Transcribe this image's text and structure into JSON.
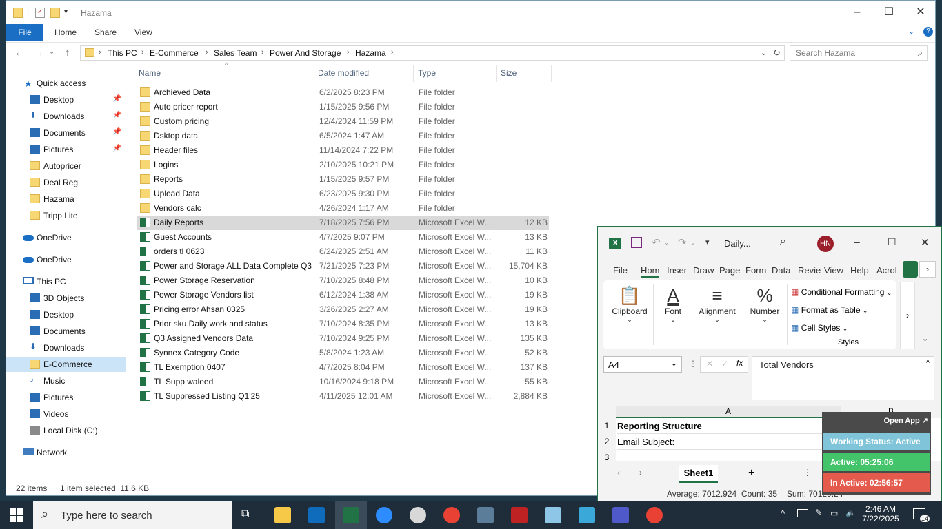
{
  "explorer": {
    "title": "Hazama",
    "ribbon_tabs": [
      "File",
      "Home",
      "Share",
      "View"
    ],
    "breadcrumbs": [
      "This PC",
      "E-Commerce",
      "Sales Team",
      "Power And Storage",
      "Hazama"
    ],
    "search_placeholder": "Search Hazama",
    "columns": {
      "name": "Name",
      "date": "Date modified",
      "type": "Type",
      "size": "Size"
    },
    "nav": {
      "quick_access": "Quick access",
      "qa_items": [
        "Desktop",
        "Downloads",
        "Documents",
        "Pictures",
        "Autopricer",
        "Deal Reg",
        "Hazama",
        "Tripp Lite"
      ],
      "onedrive1": "OneDrive",
      "onedrive2": "OneDrive",
      "this_pc": "This PC",
      "pc_items": [
        "3D Objects",
        "Desktop",
        "Documents",
        "Downloads",
        "E-Commerce",
        "Music",
        "Pictures",
        "Videos",
        "Local Disk (C:)"
      ],
      "network": "Network"
    },
    "files": [
      {
        "name": "Archieved Data",
        "date": "6/2/2025 8:23 PM",
        "type": "File folder",
        "size": "",
        "kind": "folder"
      },
      {
        "name": "Auto pricer report",
        "date": "1/15/2025 9:56 PM",
        "type": "File folder",
        "size": "",
        "kind": "folder"
      },
      {
        "name": "Custom pricing",
        "date": "12/4/2024 11:59 PM",
        "type": "File folder",
        "size": "",
        "kind": "folder"
      },
      {
        "name": "Dsktop data",
        "date": "6/5/2024 1:47 AM",
        "type": "File folder",
        "size": "",
        "kind": "folder"
      },
      {
        "name": "Header files",
        "date": "11/14/2024 7:22 PM",
        "type": "File folder",
        "size": "",
        "kind": "folder"
      },
      {
        "name": "Logins",
        "date": "2/10/2025 10:21 PM",
        "type": "File folder",
        "size": "",
        "kind": "folder"
      },
      {
        "name": "Reports",
        "date": "1/15/2025 9:57 PM",
        "type": "File folder",
        "size": "",
        "kind": "folder"
      },
      {
        "name": "Upload Data",
        "date": "6/23/2025 9:30 PM",
        "type": "File folder",
        "size": "",
        "kind": "folder"
      },
      {
        "name": "Vendors calc",
        "date": "4/26/2024 1:17 AM",
        "type": "File folder",
        "size": "",
        "kind": "folder"
      },
      {
        "name": "Daily Reports",
        "date": "7/18/2025 7:56 PM",
        "type": "Microsoft Excel W...",
        "size": "12 KB",
        "kind": "excel"
      },
      {
        "name": "Guest Accounts",
        "date": "4/7/2025 9:07 PM",
        "type": "Microsoft Excel W...",
        "size": "13 KB",
        "kind": "excel"
      },
      {
        "name": "orders tl 0623",
        "date": "6/24/2025 2:51 AM",
        "type": "Microsoft Excel W...",
        "size": "11 KB",
        "kind": "excel"
      },
      {
        "name": "Power and Storage ALL Data Complete Q3",
        "date": "7/21/2025 7:23 PM",
        "type": "Microsoft Excel W...",
        "size": "15,704 KB",
        "kind": "excel"
      },
      {
        "name": "Power Storage Reservation",
        "date": "7/10/2025 8:48 PM",
        "type": "Microsoft Excel W...",
        "size": "10 KB",
        "kind": "excel"
      },
      {
        "name": "Power Storage Vendors list",
        "date": "6/12/2024 1:38 AM",
        "type": "Microsoft Excel W...",
        "size": "19 KB",
        "kind": "excel"
      },
      {
        "name": "Pricing error Ahsan 0325",
        "date": "3/26/2025 2:27 AM",
        "type": "Microsoft Excel W...",
        "size": "19 KB",
        "kind": "excel"
      },
      {
        "name": "Prior sku Daily work and status",
        "date": "7/10/2024 8:35 PM",
        "type": "Microsoft Excel W...",
        "size": "13 KB",
        "kind": "excel"
      },
      {
        "name": "Q3 Assigned Vendors Data",
        "date": "7/10/2024 9:25 PM",
        "type": "Microsoft Excel W...",
        "size": "135 KB",
        "kind": "excel"
      },
      {
        "name": "Synnex Category Code",
        "date": "5/8/2024 1:23 AM",
        "type": "Microsoft Excel W...",
        "size": "52 KB",
        "kind": "excel"
      },
      {
        "name": "TL Exemption 0407",
        "date": "4/7/2025 8:04 PM",
        "type": "Microsoft Excel W...",
        "size": "137 KB",
        "kind": "excel"
      },
      {
        "name": "TL Supp waleed",
        "date": "10/16/2024 9:18 PM",
        "type": "Microsoft Excel W...",
        "size": "55 KB",
        "kind": "excel"
      },
      {
        "name": "TL Suppressed Listing Q1'25",
        "date": "4/11/2025 12:01 AM",
        "type": "Microsoft Excel W...",
        "size": "2,884 KB",
        "kind": "excel"
      }
    ],
    "selected_index": 9,
    "status": {
      "items": "22 items",
      "selected": "1 item selected  11.6 KB"
    }
  },
  "excel": {
    "doc_title": "Daily...",
    "avatar": "HN",
    "tabs": [
      "File",
      "Hom",
      "Inser",
      "Draw",
      "Page",
      "Form",
      "Data",
      "Revie",
      "View",
      "Help",
      "Acrol"
    ],
    "groups": [
      "Clipboard",
      "Font",
      "Alignment",
      "Number"
    ],
    "styles": [
      "Conditional Formatting",
      "Format as Table",
      "Cell Styles"
    ],
    "styles_label": "Styles",
    "namebox": "A4",
    "formula": "Total Vendors",
    "col_a": "A",
    "col_b": "B",
    "rows": [
      {
        "num": "1",
        "value": "Reporting Structure",
        "bold": true
      },
      {
        "num": "2",
        "value": "Email Subject:",
        "bold": false
      },
      {
        "num": "3",
        "value": "",
        "bold": false
      }
    ],
    "sheet": "Sheet1",
    "status": {
      "average": "Average: 7012.924",
      "count": "Count: 35",
      "sum": "Sum: 70129.24"
    }
  },
  "widget": {
    "open_app": "Open App ↗",
    "working": "Working Status: Active",
    "active": "Active: 05:25:06",
    "inactive": "In Active: 02:56:57"
  },
  "taskbar": {
    "search": "Type here to search",
    "time": "2:46 AM",
    "date": "7/22/2025",
    "notif": "14"
  },
  "colors": {
    "accent": "#1a6ec4",
    "excel_green": "#217346",
    "widget_working": "#7fc4d8",
    "widget_active": "#43c46a",
    "widget_inactive": "#e45a4c"
  }
}
